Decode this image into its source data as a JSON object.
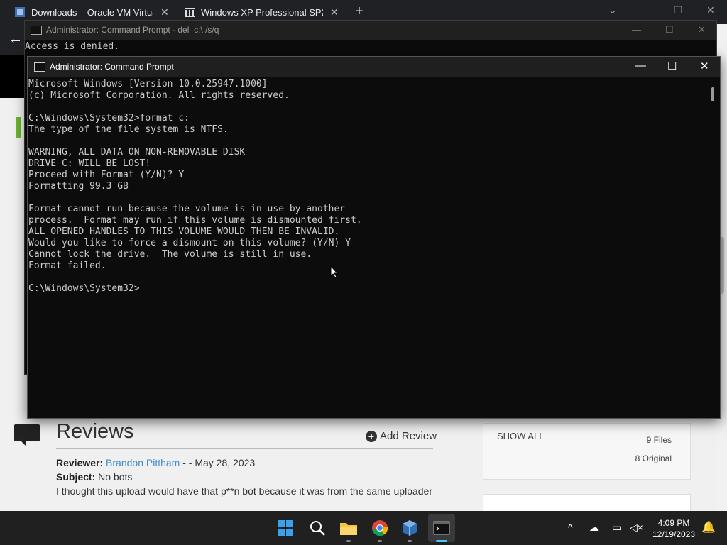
{
  "browser": {
    "tabs": [
      {
        "title": "Downloads – Oracle VM VirtualB",
        "close": "✕"
      },
      {
        "title": "Windows XP Professional SP2 (H",
        "close": "✕"
      }
    ],
    "new_tab": "+"
  },
  "back_window": {
    "title": "Administrator: Command Prompt - del  c:\\ /s/q",
    "lines": [
      "Access is denied."
    ]
  },
  "front_window": {
    "title": "Administrator: Command Prompt",
    "lines": [
      "Microsoft Windows [Version 10.0.25947.1000]",
      "(c) Microsoft Corporation. All rights reserved.",
      "",
      "C:\\Windows\\System32>format c:",
      "The type of the file system is NTFS.",
      "",
      "WARNING, ALL DATA ON NON-REMOVABLE DISK",
      "DRIVE C: WILL BE LOST!",
      "Proceed with Format (Y/N)? Y",
      "Formatting 99.3 GB",
      "",
      "Format cannot run because the volume is in use by another",
      "process.  Format may run if this volume is dismounted first.",
      "ALL OPENED HANDLES TO THIS VOLUME WOULD THEN BE INVALID.",
      "Would you like to force a dismount on this volume? (Y/N) Y",
      "Cannot lock the drive.  The volume is still in use.",
      "Format failed.",
      "",
      "C:\\Windows\\System32>"
    ]
  },
  "reviews": {
    "heading": "Reviews",
    "add_review": "Add Review",
    "reviewer_label": "Reviewer:",
    "reviewer_name": "Brandon Pittham",
    "reviewer_date": " - - May 28, 2023",
    "subject_label": "Subject:",
    "subject_text": "No bots",
    "body": "I thought this upload would have that p**n bot because it was from the same uploader"
  },
  "sidebar": {
    "show_all": "SHOW ALL",
    "files": "9 Files",
    "original": "8 Original"
  },
  "taskbar": {
    "time": "4:09 PM",
    "date": "12/19/2023"
  },
  "colors": {
    "console_bg": "#0c0c0c",
    "console_text": "#cccccc",
    "link": "#428bca",
    "taskbar_bg": "#202020"
  }
}
